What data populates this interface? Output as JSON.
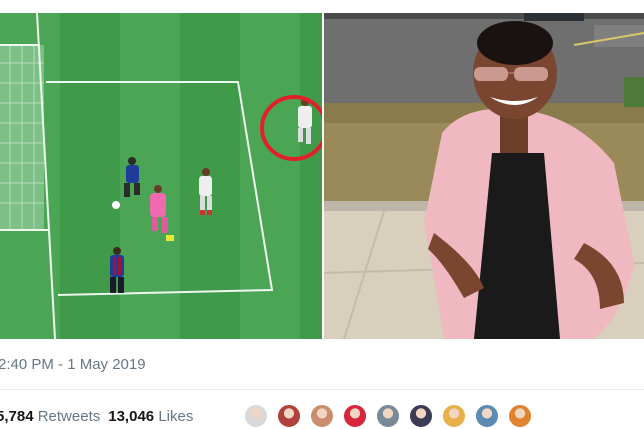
{
  "tweet": {
    "timestamp": "2:40 PM - 1 May 2019",
    "retweets_count": "5,784",
    "retweets_label": "Retweets",
    "likes_count": "13,046",
    "likes_label": "Likes"
  },
  "media": {
    "left_image": "football-pitch-photo",
    "right_image": "woman-squinting-meme-photo"
  },
  "likers": {
    "avatar_colors": [
      "#d9d9d9",
      "#b0413e",
      "#c98c6e",
      "#d7263d",
      "#7a8a99",
      "#3b3b55",
      "#e8b04b",
      "#5b8bb3",
      "#e0822e"
    ]
  }
}
